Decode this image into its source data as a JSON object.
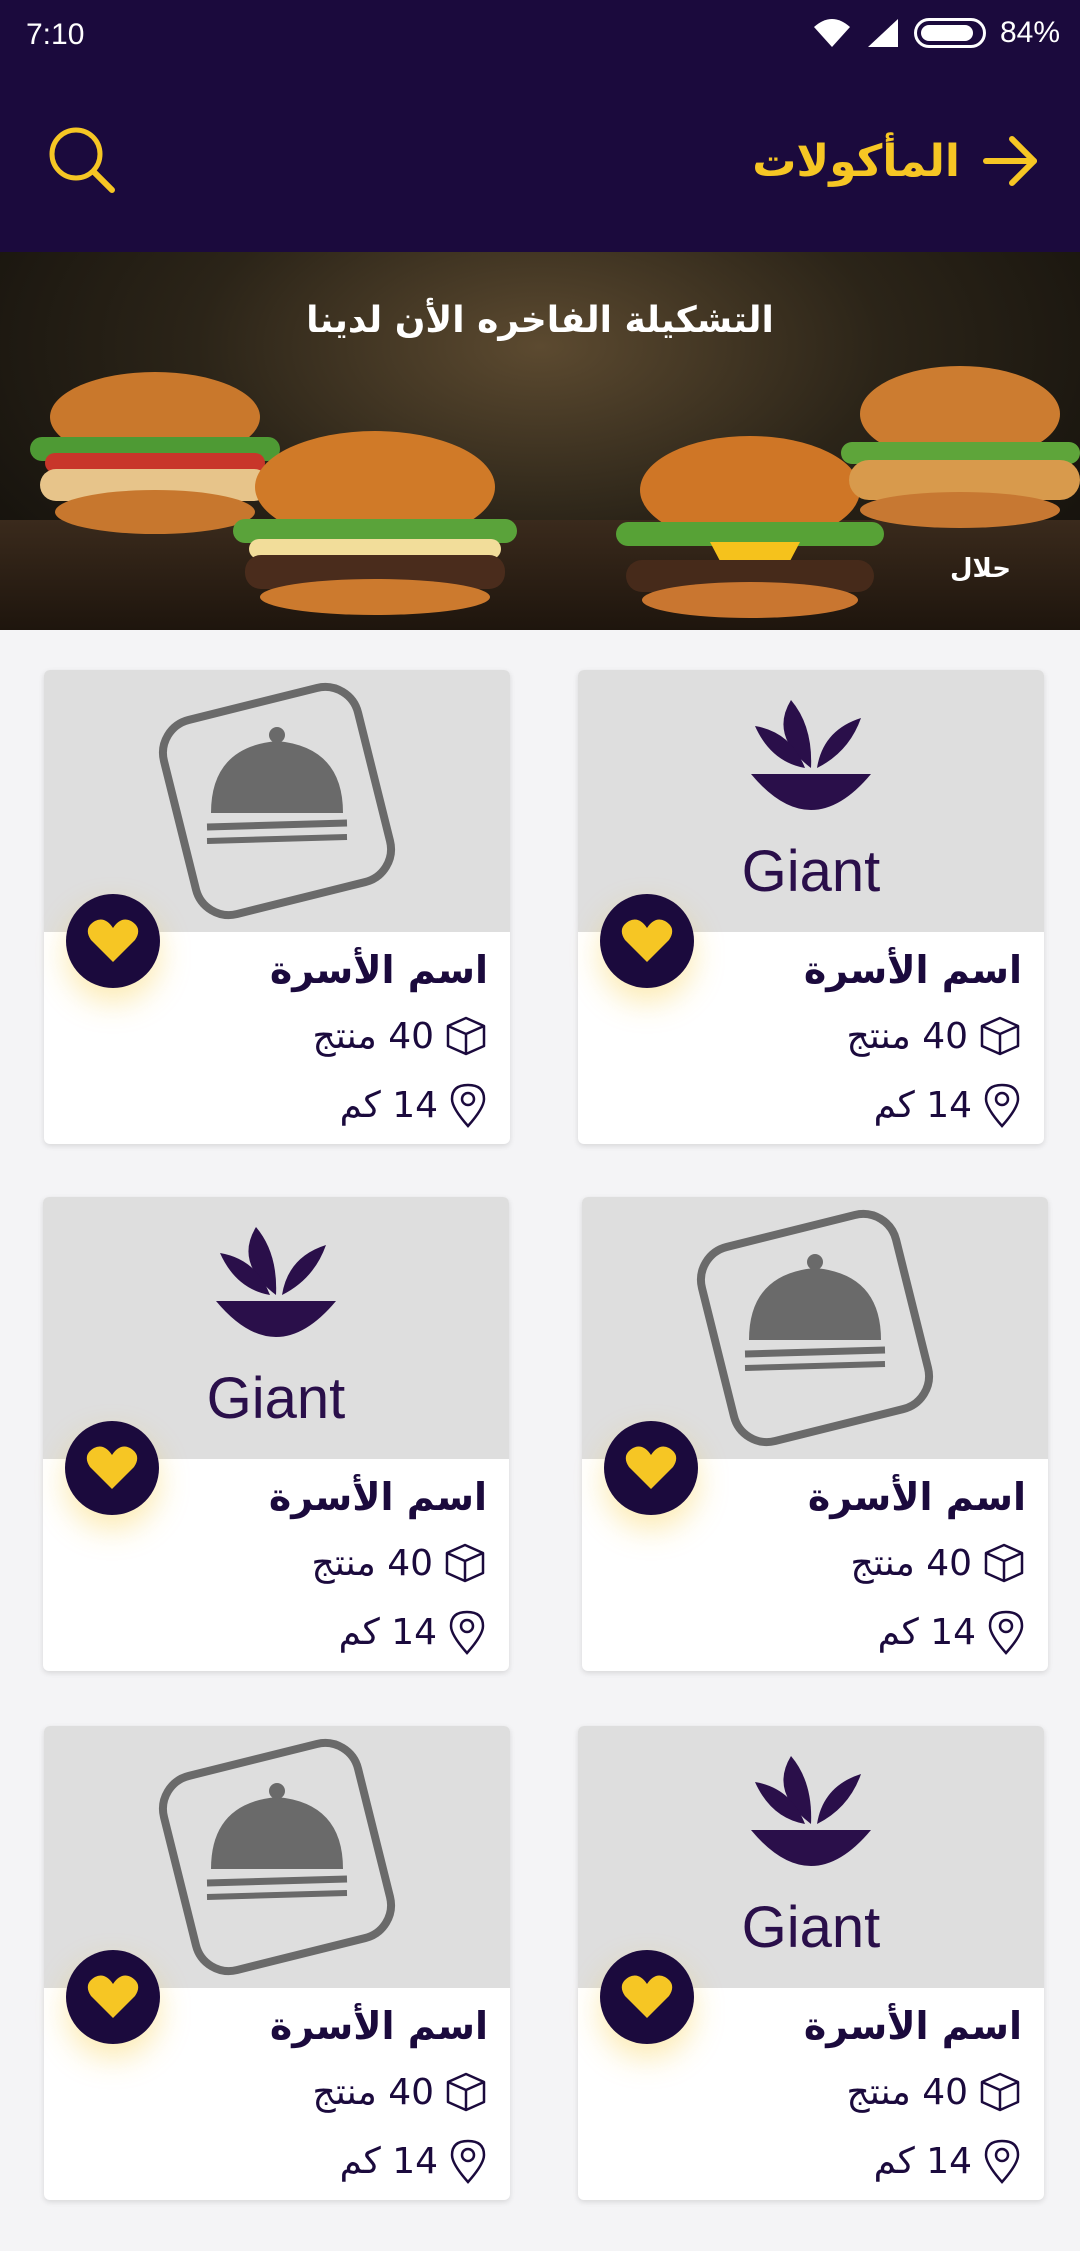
{
  "status_bar": {
    "time": "7:10",
    "battery": "84%"
  },
  "header": {
    "title": "المأكولات"
  },
  "banner": {
    "headline": "التشكيلة الفاخره الأن لدينا",
    "badge": "حلال"
  },
  "cards": [
    {
      "name": "اسم الأسرة",
      "products": "40 منتج",
      "distance": "14 كم",
      "logo": "giant-logo",
      "logo_text": "Giant"
    },
    {
      "name": "اسم الأسرة",
      "products": "40 منتج",
      "distance": "14 كم",
      "logo": "food-cloche-logo"
    },
    {
      "name": "اسم الأسرة",
      "products": "40 منتج",
      "distance": "14 كم",
      "logo": "food-cloche-logo"
    },
    {
      "name": "اسم الأسرة",
      "products": "40 منتج",
      "distance": "14 كم",
      "logo": "giant-logo",
      "logo_text": "Giant"
    },
    {
      "name": "اسم الأسرة",
      "products": "40 منتج",
      "distance": "14 كم",
      "logo": "giant-logo",
      "logo_text": "Giant"
    },
    {
      "name": "اسم الأسرة",
      "products": "40 منتج",
      "distance": "14 كم",
      "logo": "food-cloche-logo"
    }
  ],
  "colors": {
    "primary": "#1b0a3d",
    "accent": "#f6c624",
    "card_image_bg": "#dedede"
  }
}
